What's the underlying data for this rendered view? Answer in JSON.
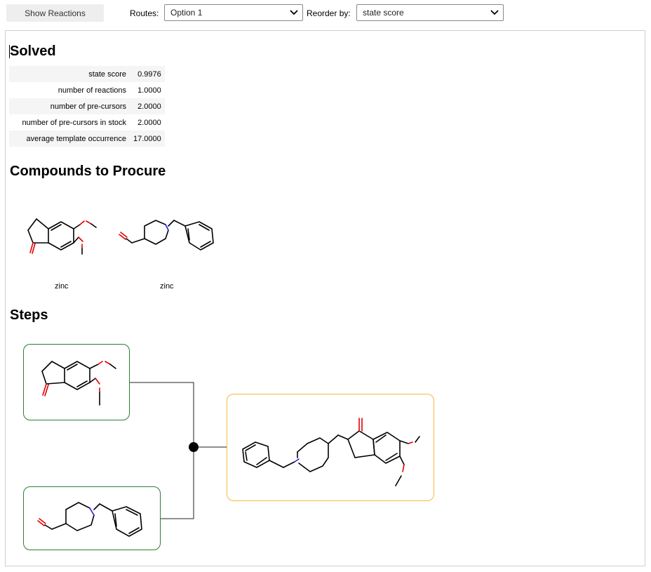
{
  "toolbar": {
    "show_reactions_label": "Show Reactions",
    "routes_label": "Routes:",
    "routes_value": "Option 1",
    "reorder_label": "Reorder by:",
    "reorder_value": "state score"
  },
  "sections": {
    "solved": "Solved",
    "procure": "Compounds to Procure",
    "steps": "Steps"
  },
  "stats": [
    {
      "key": "state score",
      "value": "0.9976"
    },
    {
      "key": "number of reactions",
      "value": "1.0000"
    },
    {
      "key": "number of pre-cursors",
      "value": "2.0000"
    },
    {
      "key": "number of pre-cursors in stock",
      "value": "2.0000"
    },
    {
      "key": "average template occurrence",
      "value": "17.0000"
    }
  ],
  "procure": [
    {
      "stock": "zinc"
    },
    {
      "stock": "zinc"
    }
  ],
  "colors": {
    "in_stock_border": "#2e7d32",
    "target_border": "#f5b942",
    "oxygen": "#e00000",
    "nitrogen": "#2020e0"
  }
}
